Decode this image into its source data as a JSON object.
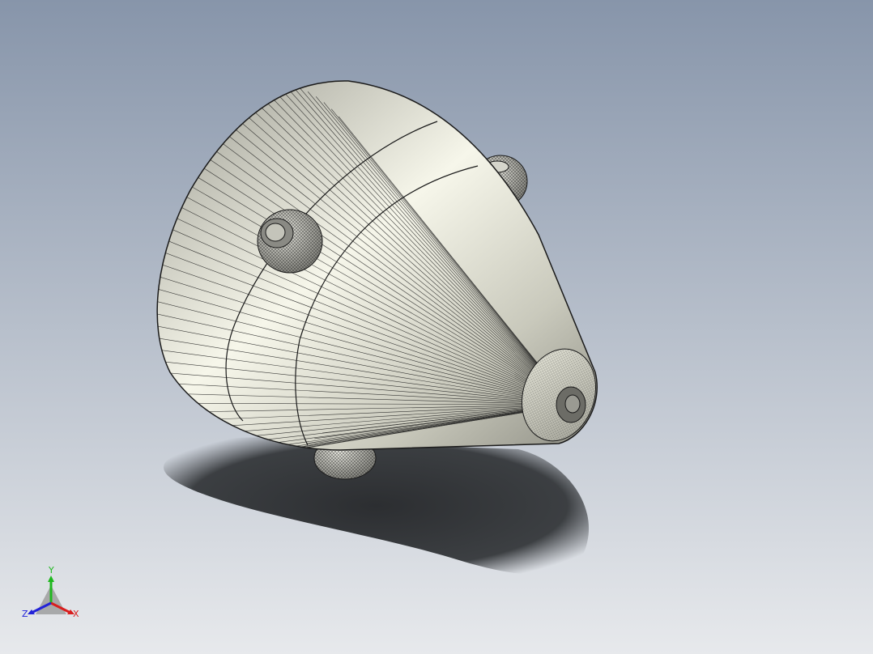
{
  "viewport": {
    "background_top": "#8795aa",
    "background_bottom": "#e7e9ec",
    "model_fill_light": "#f6f6ea",
    "model_fill_mid": "#c9c9bc",
    "model_fill_dark": "#8e8e84",
    "edge_color": "#1a1a1a",
    "shadow_color": "#2c2e31",
    "model_icon": "cone-mouse-model"
  },
  "triad": {
    "x_label": "X",
    "y_label": "Y",
    "z_label": "Z",
    "x_color": "#d81e1e",
    "y_color": "#1fb81f",
    "z_color": "#2222d8"
  }
}
